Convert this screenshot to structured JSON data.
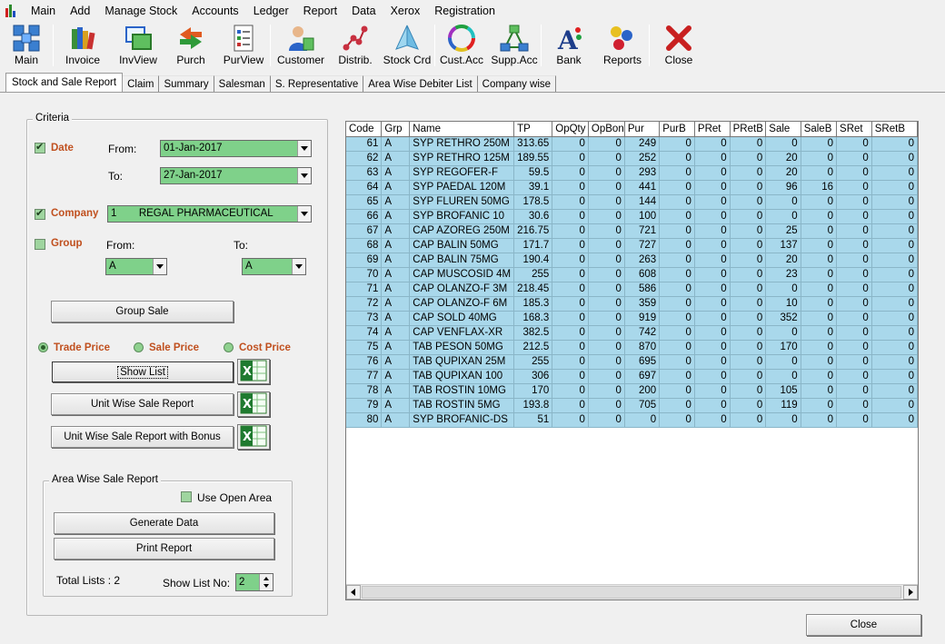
{
  "menu": [
    "Main",
    "Add",
    "Manage Stock",
    "Accounts",
    "Ledger",
    "Report",
    "Data",
    "Xerox",
    "Registration"
  ],
  "toolbar": [
    {
      "label": "Main",
      "icon": "grid-blocks-icon"
    },
    {
      "label": "Invoice",
      "icon": "books-icon"
    },
    {
      "label": "InvView",
      "icon": "windows-icon"
    },
    {
      "label": "Purch",
      "icon": "exchange-arrows-icon"
    },
    {
      "label": "PurView",
      "icon": "checklist-icon"
    },
    {
      "label": "Customer",
      "icon": "person-icon"
    },
    {
      "label": "Distrib.",
      "icon": "distribution-nodes-icon"
    },
    {
      "label": "Stock Crd",
      "icon": "pyramid-icon"
    },
    {
      "label": "Cust.Acc",
      "icon": "color-wheel-icon"
    },
    {
      "label": "Supp.Acc",
      "icon": "network-icon"
    },
    {
      "label": "Bank",
      "icon": "font-letter-icon"
    },
    {
      "label": "Reports",
      "icon": "colored-dots-icon"
    },
    {
      "label": "Close",
      "icon": "red-x-icon"
    }
  ],
  "tabs": [
    "Stock and Sale Report",
    "Claim",
    "Summary",
    "Salesman",
    "S. Representative",
    "Area Wise Debiter List",
    "Company wise"
  ],
  "criteria": {
    "legend": "Criteria",
    "date_label": "Date",
    "from_label": "From:",
    "to_label": "To:",
    "date_from": "01-Jan-2017",
    "date_to": "27-Jan-2017",
    "company_label": "Company",
    "company_code": "1",
    "company_value": "REGAL PHARMACEUTICAL",
    "group_label": "Group",
    "group_from_label": "From:",
    "group_to_label": "To:",
    "group_from": "A",
    "group_to": "A",
    "group_sale_button": "Group Sale",
    "trade_price": "Trade Price",
    "sale_price": "Sale Price",
    "cost_price": "Cost Price",
    "show_list_button": "Show List",
    "unit_wise_button": "Unit Wise Sale Report",
    "unit_wise_bonus_button": "Unit Wise Sale Report with Bonus"
  },
  "area": {
    "legend": "Area Wise Sale Report",
    "use_open_area": "Use Open Area",
    "generate_button": "Generate  Data",
    "print_button": "Print Report",
    "total_lists_label": "Total Lists : 2",
    "show_list_no_label": "Show List No:",
    "show_list_no": "2"
  },
  "grid": {
    "columns": [
      "Code",
      "Grp",
      "Name",
      "TP",
      "OpQty",
      "OpBon",
      "Pur",
      "PurB",
      "PRet",
      "PRetB",
      "Sale",
      "SaleB",
      "SRet",
      "SRetB"
    ],
    "rows": [
      [
        "61",
        "A",
        "SYP RETHRO 250M",
        "313.65",
        "0",
        "0",
        "249",
        "0",
        "0",
        "0",
        "0",
        "0",
        "0",
        "0"
      ],
      [
        "62",
        "A",
        "SYP RETHRO 125M",
        "189.55",
        "0",
        "0",
        "252",
        "0",
        "0",
        "0",
        "20",
        "0",
        "0",
        "0"
      ],
      [
        "63",
        "A",
        "SYP REGOFER-F",
        "59.5",
        "0",
        "0",
        "293",
        "0",
        "0",
        "0",
        "20",
        "0",
        "0",
        "0"
      ],
      [
        "64",
        "A",
        "SYP PAEDAL 120M",
        "39.1",
        "0",
        "0",
        "441",
        "0",
        "0",
        "0",
        "96",
        "16",
        "0",
        "0"
      ],
      [
        "65",
        "A",
        "SYP FLUREN 50MG",
        "178.5",
        "0",
        "0",
        "144",
        "0",
        "0",
        "0",
        "0",
        "0",
        "0",
        "0"
      ],
      [
        "66",
        "A",
        "SYP BROFANIC 10",
        "30.6",
        "0",
        "0",
        "100",
        "0",
        "0",
        "0",
        "0",
        "0",
        "0",
        "0"
      ],
      [
        "67",
        "A",
        "CAP AZOREG 250M",
        "216.75",
        "0",
        "0",
        "721",
        "0",
        "0",
        "0",
        "25",
        "0",
        "0",
        "0"
      ],
      [
        "68",
        "A",
        "CAP BALIN 50MG",
        "171.7",
        "0",
        "0",
        "727",
        "0",
        "0",
        "0",
        "137",
        "0",
        "0",
        "0"
      ],
      [
        "69",
        "A",
        "CAP BALIN 75MG",
        "190.4",
        "0",
        "0",
        "263",
        "0",
        "0",
        "0",
        "20",
        "0",
        "0",
        "0"
      ],
      [
        "70",
        "A",
        "CAP MUSCOSID 4M",
        "255",
        "0",
        "0",
        "608",
        "0",
        "0",
        "0",
        "23",
        "0",
        "0",
        "0"
      ],
      [
        "71",
        "A",
        "CAP OLANZO-F 3M",
        "218.45",
        "0",
        "0",
        "586",
        "0",
        "0",
        "0",
        "0",
        "0",
        "0",
        "0"
      ],
      [
        "72",
        "A",
        "CAP OLANZO-F 6M",
        "185.3",
        "0",
        "0",
        "359",
        "0",
        "0",
        "0",
        "10",
        "0",
        "0",
        "0"
      ],
      [
        "73",
        "A",
        "CAP SOLD 40MG",
        "168.3",
        "0",
        "0",
        "919",
        "0",
        "0",
        "0",
        "352",
        "0",
        "0",
        "0"
      ],
      [
        "74",
        "A",
        "CAP VENFLAX-XR",
        "382.5",
        "0",
        "0",
        "742",
        "0",
        "0",
        "0",
        "0",
        "0",
        "0",
        "0"
      ],
      [
        "75",
        "A",
        "TAB PESON 50MG",
        "212.5",
        "0",
        "0",
        "870",
        "0",
        "0",
        "0",
        "170",
        "0",
        "0",
        "0"
      ],
      [
        "76",
        "A",
        "TAB QUPIXAN 25M",
        "255",
        "0",
        "0",
        "695",
        "0",
        "0",
        "0",
        "0",
        "0",
        "0",
        "0"
      ],
      [
        "77",
        "A",
        "TAB QUPIXAN 100",
        "306",
        "0",
        "0",
        "697",
        "0",
        "0",
        "0",
        "0",
        "0",
        "0",
        "0"
      ],
      [
        "78",
        "A",
        "TAB ROSTIN 10MG",
        "170",
        "0",
        "0",
        "200",
        "0",
        "0",
        "0",
        "105",
        "0",
        "0",
        "0"
      ],
      [
        "79",
        "A",
        "TAB ROSTIN 5MG",
        "193.8",
        "0",
        "0",
        "705",
        "0",
        "0",
        "0",
        "119",
        "0",
        "0",
        "0"
      ],
      [
        "80",
        "A",
        "SYP BROFANIC-DS",
        "51",
        "0",
        "0",
        "0",
        "0",
        "0",
        "0",
        "0",
        "0",
        "0",
        "0"
      ]
    ]
  },
  "footer": {
    "close_button": "Close"
  }
}
